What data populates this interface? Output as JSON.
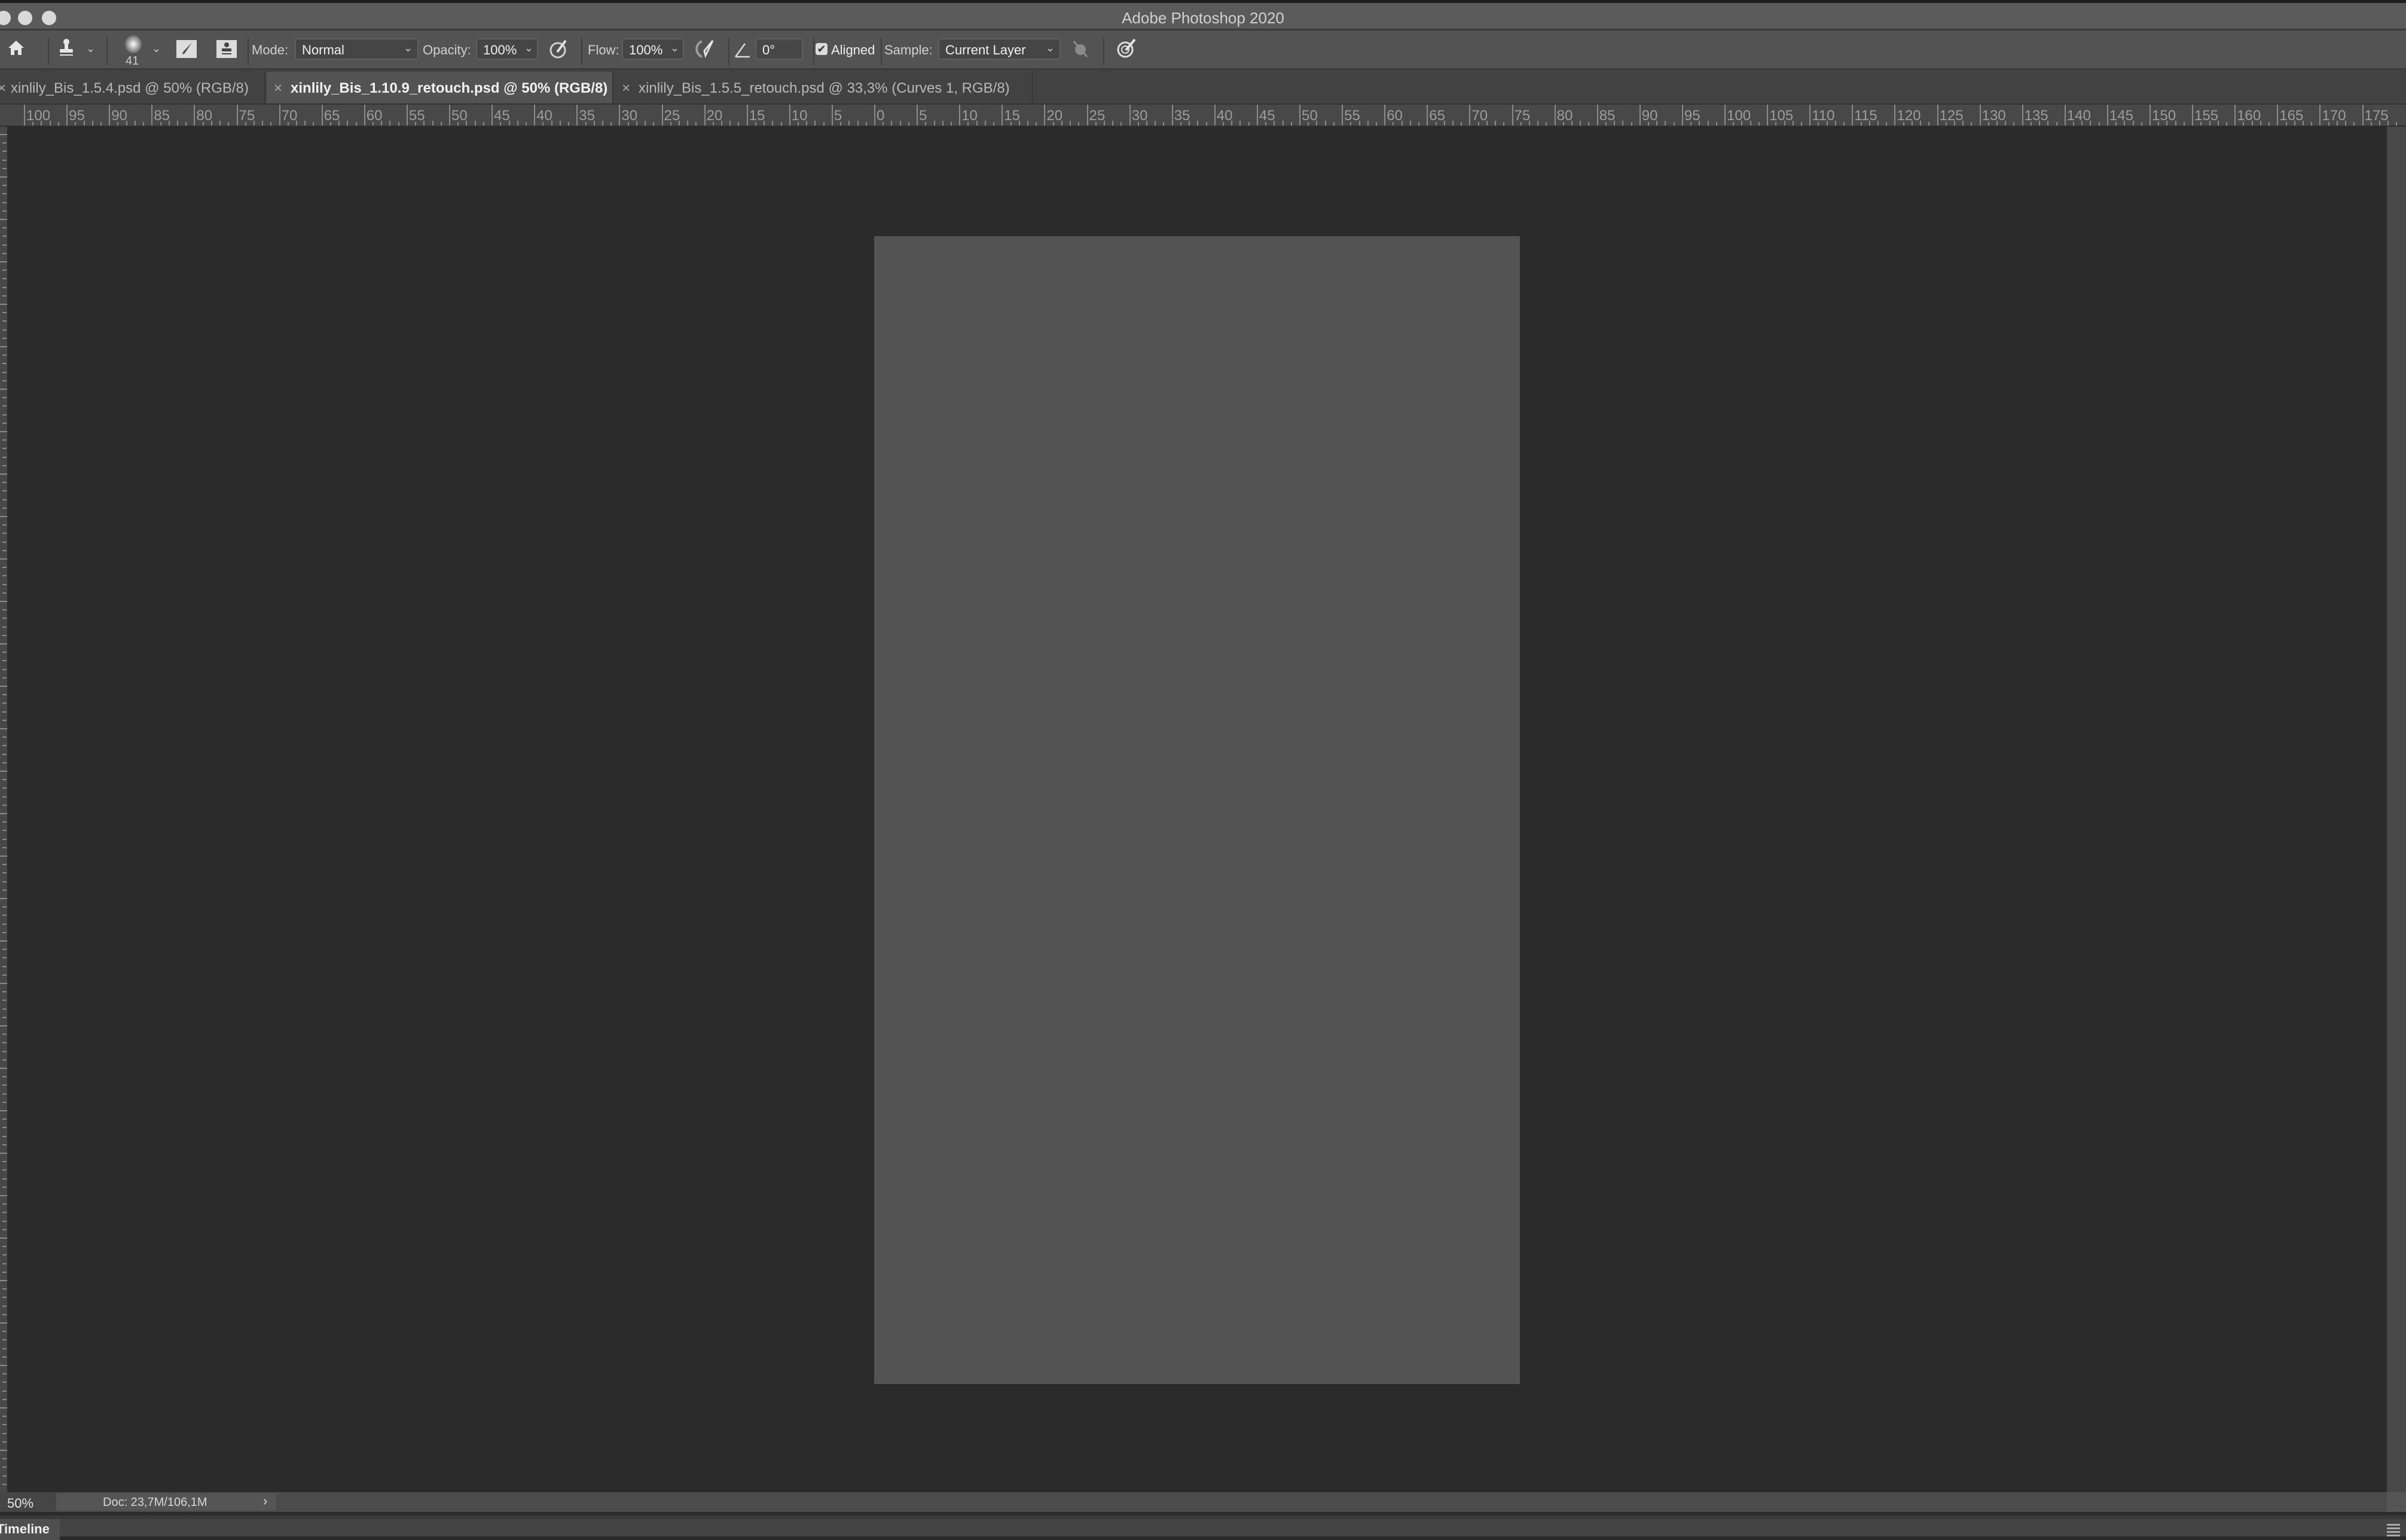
{
  "window": {
    "title": "Adobe Photoshop 2020",
    "traffic_lights": [
      "close",
      "minimize",
      "zoom"
    ]
  },
  "options_bar": {
    "tool": "clone-stamp-icon",
    "brush_size": "41",
    "mode_label": "Mode:",
    "mode_value": "Normal",
    "opacity_label": "Opacity:",
    "opacity_value": "100%",
    "flow_label": "Flow:",
    "flow_value": "100%",
    "angle_value": "0°",
    "aligned_label": "Aligned",
    "aligned_checked": true,
    "sample_label": "Sample:",
    "sample_value": "Current Layer"
  },
  "tabs": [
    {
      "label": "xinlily_Bis_1.5.4.psd @ 50% (RGB/8)",
      "active": false
    },
    {
      "label": "xinlily_Bis_1.10.9_retouch.psd @ 50% (RGB/8)",
      "active": true
    },
    {
      "label": "xinlily_Bis_1.5.5_retouch.psd @ 33,3% (Curves 1, RGB/8)",
      "active": false
    }
  ],
  "ruler": {
    "labels": [
      "100",
      "95",
      "90",
      "85",
      "80",
      "75",
      "70",
      "65",
      "60",
      "55",
      "50",
      "45",
      "40",
      "35",
      "30",
      "25",
      "20",
      "15",
      "10",
      "5",
      "0",
      "5",
      "10",
      "15",
      "20",
      "25",
      "30",
      "35",
      "40",
      "45",
      "50",
      "55",
      "60",
      "65",
      "70",
      "75",
      "80",
      "85",
      "90",
      "95",
      "100",
      "105",
      "110",
      "115",
      "120",
      "125",
      "130",
      "135",
      "140",
      "145",
      "150",
      "155",
      "160",
      "165",
      "170",
      "175"
    ]
  },
  "colors": {
    "workspace": "#2b2b2b",
    "document": "#535353"
  },
  "status_bar": {
    "zoom": "50%",
    "doc_info": "Doc: 23,7M/106,1M",
    "arrow": "›"
  },
  "timeline": {
    "label": "Timeline"
  }
}
